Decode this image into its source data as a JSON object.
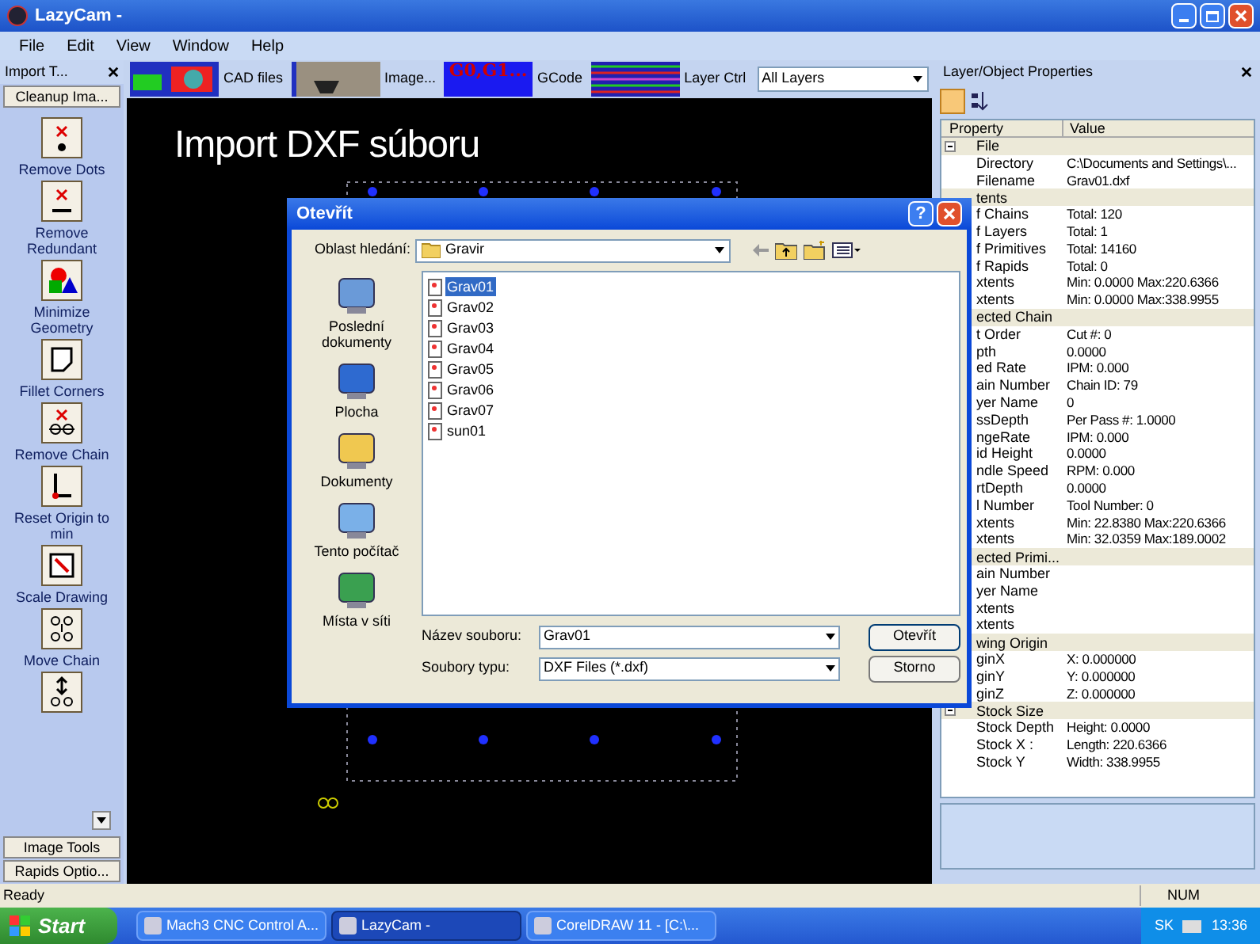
{
  "window": {
    "title": "LazyCam -"
  },
  "menu": [
    "File",
    "Edit",
    "View",
    "Window",
    "Help"
  ],
  "toolbar": {
    "buttons": [
      {
        "label": "CAD files",
        "kind": "cad"
      },
      {
        "label": "Image...",
        "kind": "image"
      },
      {
        "label": "GCode",
        "kind": "gcode",
        "thumb_text": "G0,G1..."
      },
      {
        "label": "Layer Ctrl",
        "kind": "layers"
      }
    ],
    "layer_select": "All Layers"
  },
  "left_panel": {
    "title": "Import T...",
    "top_tab": "Cleanup Ima...",
    "tools": [
      {
        "label": "Remove Dots",
        "kind": "dots"
      },
      {
        "label": "Remove Redundant",
        "kind": "redundant"
      },
      {
        "label": "Minimize Geometry",
        "kind": "minimize"
      },
      {
        "label": "Fillet Corners",
        "kind": "fillet"
      },
      {
        "label": "Remove Chain",
        "kind": "remove-chain"
      },
      {
        "label": "Reset Origin to min",
        "kind": "origin"
      },
      {
        "label": "Scale Drawing",
        "kind": "scale"
      },
      {
        "label": "Move Chain",
        "kind": "move-chain"
      },
      {
        "kind": "set-chain"
      }
    ],
    "bottom_tabs": [
      "Image Tools",
      "Rapids Optio..."
    ]
  },
  "canvas": {
    "caption": "Import DXF súboru"
  },
  "properties": {
    "title": "Layer/Object Properties",
    "columns": [
      "Property",
      "Value"
    ],
    "rows": [
      {
        "kind": "group",
        "name": "File",
        "expanded": true
      },
      {
        "kind": "prop",
        "name": "Directory",
        "value": "C:\\Documents and Settings\\..."
      },
      {
        "kind": "prop",
        "name": "Filename",
        "value": "Grav01.dxf"
      },
      {
        "kind": "group",
        "name": "tents"
      },
      {
        "kind": "prop",
        "name": "f Chains",
        "value": "Total: 120"
      },
      {
        "kind": "prop",
        "name": "f Layers",
        "value": "Total: 1"
      },
      {
        "kind": "prop",
        "name": "f Primitives",
        "value": "Total: 14160"
      },
      {
        "kind": "prop",
        "name": "f Rapids",
        "value": "Total: 0"
      },
      {
        "kind": "prop",
        "name": "xtents",
        "value": "Min: 0.0000 Max:220.6366"
      },
      {
        "kind": "prop",
        "name": "xtents",
        "value": "Min: 0.0000 Max:338.9955"
      },
      {
        "kind": "group",
        "name": "ected Chain"
      },
      {
        "kind": "prop",
        "name": "t Order",
        "value": "Cut #: 0"
      },
      {
        "kind": "prop",
        "name": "pth",
        "value": "0.0000"
      },
      {
        "kind": "prop",
        "name": "ed Rate",
        "value": "IPM: 0.000"
      },
      {
        "kind": "prop",
        "name": "ain Number",
        "value": "Chain ID: 79"
      },
      {
        "kind": "prop",
        "name": "yer Name",
        "value": "0"
      },
      {
        "kind": "prop",
        "name": "ssDepth",
        "value": "Per Pass #: 1.0000"
      },
      {
        "kind": "prop",
        "name": "ngeRate",
        "value": "IPM: 0.000"
      },
      {
        "kind": "prop",
        "name": "id Height",
        "value": "0.0000"
      },
      {
        "kind": "prop",
        "name": "ndle Speed",
        "value": "RPM: 0.000"
      },
      {
        "kind": "prop",
        "name": "rtDepth",
        "value": "0.0000"
      },
      {
        "kind": "prop",
        "name": "l Number",
        "value": "Tool Number: 0"
      },
      {
        "kind": "prop",
        "name": "xtents",
        "value": "Min: 22.8380 Max:220.6366"
      },
      {
        "kind": "prop",
        "name": "xtents",
        "value": "Min: 32.0359 Max:189.0002"
      },
      {
        "kind": "group",
        "name": "ected Primi..."
      },
      {
        "kind": "prop",
        "name": "ain Number"
      },
      {
        "kind": "prop",
        "name": "yer Name"
      },
      {
        "kind": "prop",
        "name": "xtents"
      },
      {
        "kind": "prop",
        "name": "xtents"
      },
      {
        "kind": "group",
        "name": "wing Origin"
      },
      {
        "kind": "prop",
        "name": "ginX",
        "value": "X: 0.000000"
      },
      {
        "kind": "prop",
        "name": "ginY",
        "value": "Y: 0.000000"
      },
      {
        "kind": "prop",
        "name": "ginZ",
        "value": "Z: 0.000000"
      },
      {
        "kind": "group",
        "name": "Stock Size",
        "expanded": true
      },
      {
        "kind": "prop",
        "name": "Stock Depth",
        "value": "Height: 0.0000"
      },
      {
        "kind": "prop",
        "name": "Stock X :",
        "value": "Length: 220.6366"
      },
      {
        "kind": "prop",
        "name": "Stock Y",
        "value": "Width: 338.9955"
      }
    ]
  },
  "dialog": {
    "title": "Otevřít",
    "help_label": "?",
    "look_in_label": "Oblast hledání:",
    "look_in": "Gravir",
    "places": [
      {
        "label": "Poslední dokumenty",
        "kind": "recent"
      },
      {
        "label": "Plocha",
        "kind": "desktop"
      },
      {
        "label": "Dokumenty",
        "kind": "documents"
      },
      {
        "label": "Tento počítač",
        "kind": "computer"
      },
      {
        "label": "Místa v síti",
        "kind": "network"
      }
    ],
    "files": [
      {
        "name": "Grav01",
        "selected": true
      },
      {
        "name": "Grav02",
        "selected": false
      },
      {
        "name": "Grav03",
        "selected": false
      },
      {
        "name": "Grav04",
        "selected": false
      },
      {
        "name": "Grav05",
        "selected": false
      },
      {
        "name": "Grav06",
        "selected": false
      },
      {
        "name": "Grav07",
        "selected": false
      },
      {
        "name": "sun01",
        "selected": false
      }
    ],
    "filename_label": "Název souboru:",
    "filename": "Grav01",
    "filetype_label": "Soubory typu:",
    "filetype": "DXF Files (*.dxf)",
    "buttons": [
      "Otevřít",
      "Storno"
    ]
  },
  "status_bar": {
    "text": "Ready",
    "indicator": "NUM"
  },
  "taskbar": {
    "start": "Start",
    "tasks": [
      {
        "label": "Mach3 CNC Control A...",
        "selected": false
      },
      {
        "label": "LazyCam -",
        "selected": true
      },
      {
        "label": "CorelDRAW 11 - [C:\\...",
        "selected": false
      }
    ],
    "lang": "SK",
    "clock": "13:36"
  }
}
